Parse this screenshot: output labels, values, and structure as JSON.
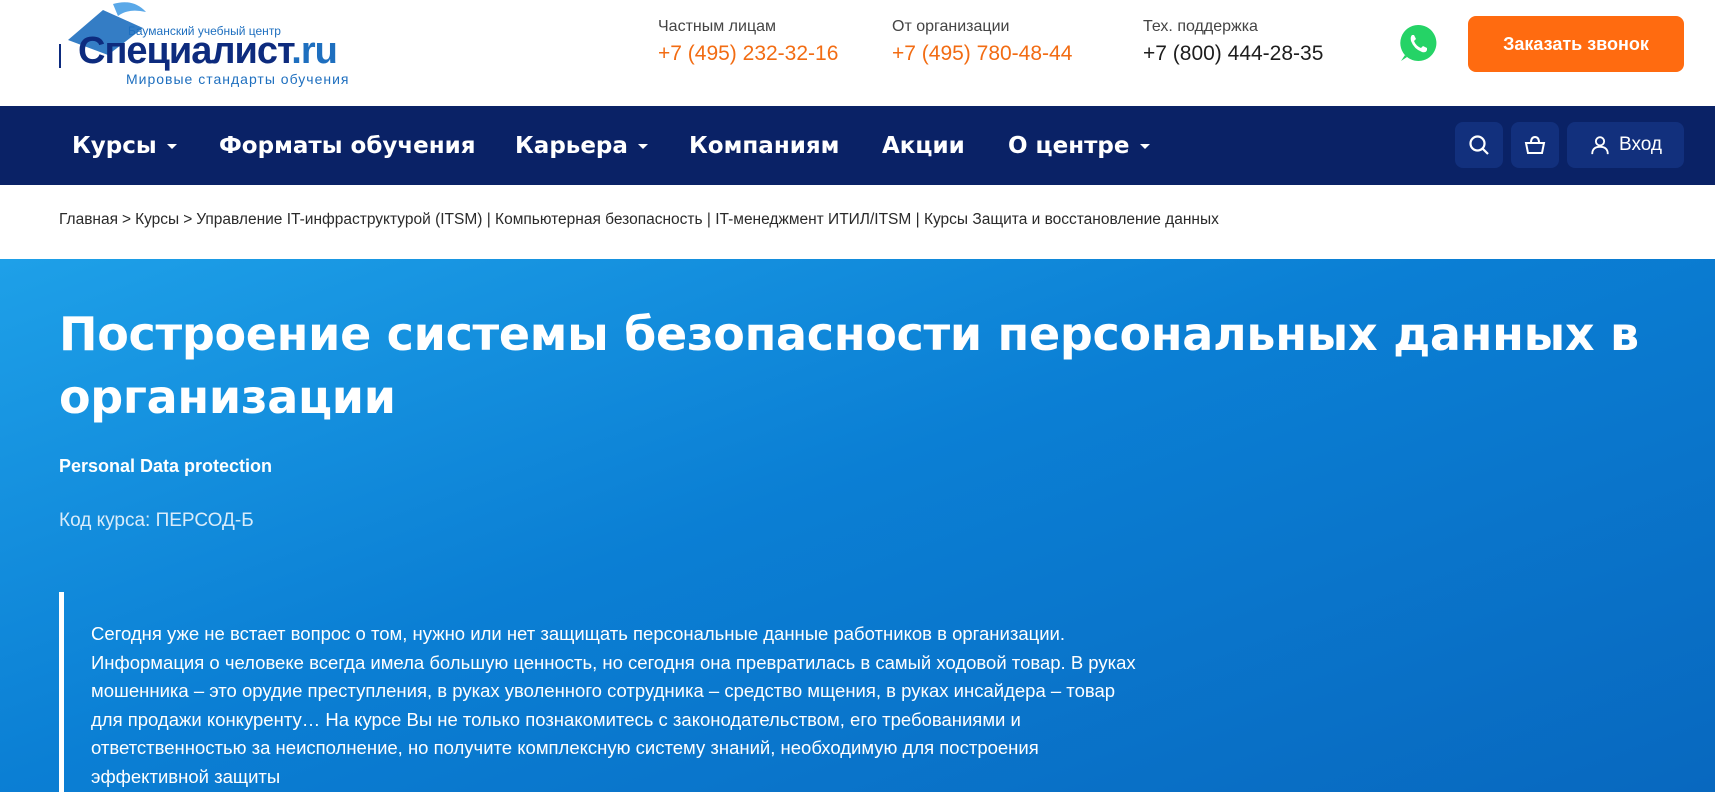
{
  "logo": {
    "subtitle_top": "Бауманский учебный центр",
    "brand_main": "Специалист",
    "brand_tld": ".ru",
    "slogan": "Мировые стандарты обучения"
  },
  "contacts": [
    {
      "label": "Частным лицам",
      "phone": "+7 (495) 232-32-16"
    },
    {
      "label": "От организации",
      "phone": "+7 (495) 780-48-44"
    },
    {
      "label": "Тех. поддержка",
      "phone": "+7 (800) 444-28-35"
    }
  ],
  "whatsapp_icon": "whatsapp-icon",
  "callback_button": "Заказать звонок",
  "nav": {
    "items": [
      {
        "label": "Курсы"
      },
      {
        "label": "Форматы обучения"
      },
      {
        "label": "Карьера"
      },
      {
        "label": "Компаниям"
      },
      {
        "label": "Акции"
      },
      {
        "label": "О центре"
      }
    ],
    "login_label": "Вход"
  },
  "breadcrumb": {
    "home": "Главная",
    "courses": "Курсы",
    "trail": "Управление IT-инфраструктурой (ITSM) | Компьютерная безопасность | IT-менеджмент ИТИЛ/ITSM | Курсы Защита и восстановление данных"
  },
  "course": {
    "title": "Построение системы безопасности персональных данных в организации",
    "title_en": "Personal Data protection",
    "code": "Код курса: ПЕРСОД-Б",
    "description": "Сегодня уже не встает вопрос о том, нужно или нет защищать персональные данные работников в организации. Информация о человеке всегда имела большую ценность, но сегодня она превратилась в самый ходовой товар. В руках мошенника – это орудие преступления, в руках уволенного сотрудника – средство мщения, в руках инсайдера – товар для продажи конкуренту… На курсе Вы не только познакомитесь с законодательством, его требованиями и ответственностью за неисполнение, но получите комплексную систему знаний, необходимую для построения эффективной защиты"
  },
  "colors": {
    "accent_orange": "#ff6b10",
    "nav_bg": "#0a2266",
    "hero_blue": "#0b7fd4"
  }
}
